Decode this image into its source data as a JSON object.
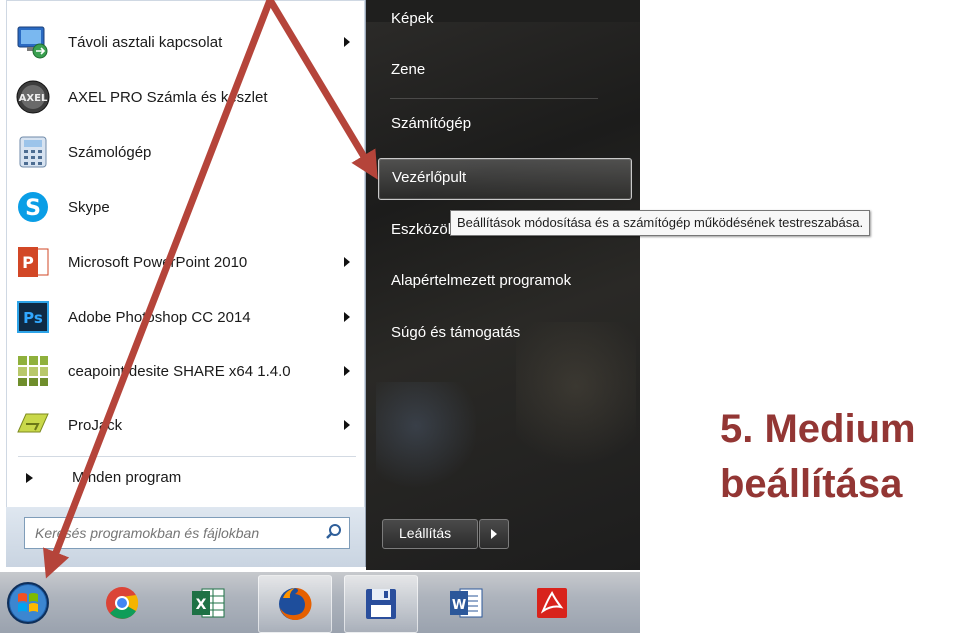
{
  "start_menu": {
    "programs": [
      {
        "label": "Távoli asztali kapcsolat",
        "icon": "remote-desktop-icon",
        "has_submenu": true
      },
      {
        "label": "AXEL PRO Számla és készlet",
        "icon": "axel-logo-icon",
        "has_submenu": false
      },
      {
        "label": "Számológép",
        "icon": "calculator-icon",
        "has_submenu": false
      },
      {
        "label": "Skype",
        "icon": "skype-icon",
        "has_submenu": false
      },
      {
        "label": "Microsoft PowerPoint 2010",
        "icon": "powerpoint-icon",
        "has_submenu": true
      },
      {
        "label": "Adobe Photoshop CC 2014",
        "icon": "photoshop-icon",
        "has_submenu": true
      },
      {
        "label": "ceapoint desite SHARE x64 1.4.0",
        "icon": "ceapoint-icon",
        "has_submenu": true
      },
      {
        "label": "ProJack",
        "icon": "projack-icon",
        "has_submenu": true
      }
    ],
    "all_programs_label": "Minden program",
    "search_placeholder": "Keresés programokban és fájlokban",
    "right_items": [
      {
        "label": "Képek"
      },
      {
        "label": "Zene"
      },
      {
        "label": "Számítógép"
      },
      {
        "label": "Vezérlőpult",
        "highlighted": true
      },
      {
        "label": "Eszközök"
      },
      {
        "label": "Alapértelmezett programok"
      },
      {
        "label": "Súgó és támogatás"
      }
    ],
    "shutdown_label": "Leállítás"
  },
  "tooltip": "Beállítások módosítása és a számítógép működésének testreszabása.",
  "caption": {
    "line1": "5. Medium",
    "line2": "beállítása",
    "color": "#933634"
  },
  "taskbar": {
    "items": [
      "start-orb-icon",
      "chrome-icon",
      "excel-icon",
      "firefox-icon",
      "save-floppy-icon",
      "word-icon",
      "acrobat-icon"
    ]
  },
  "annotation_color": "#b5443a"
}
